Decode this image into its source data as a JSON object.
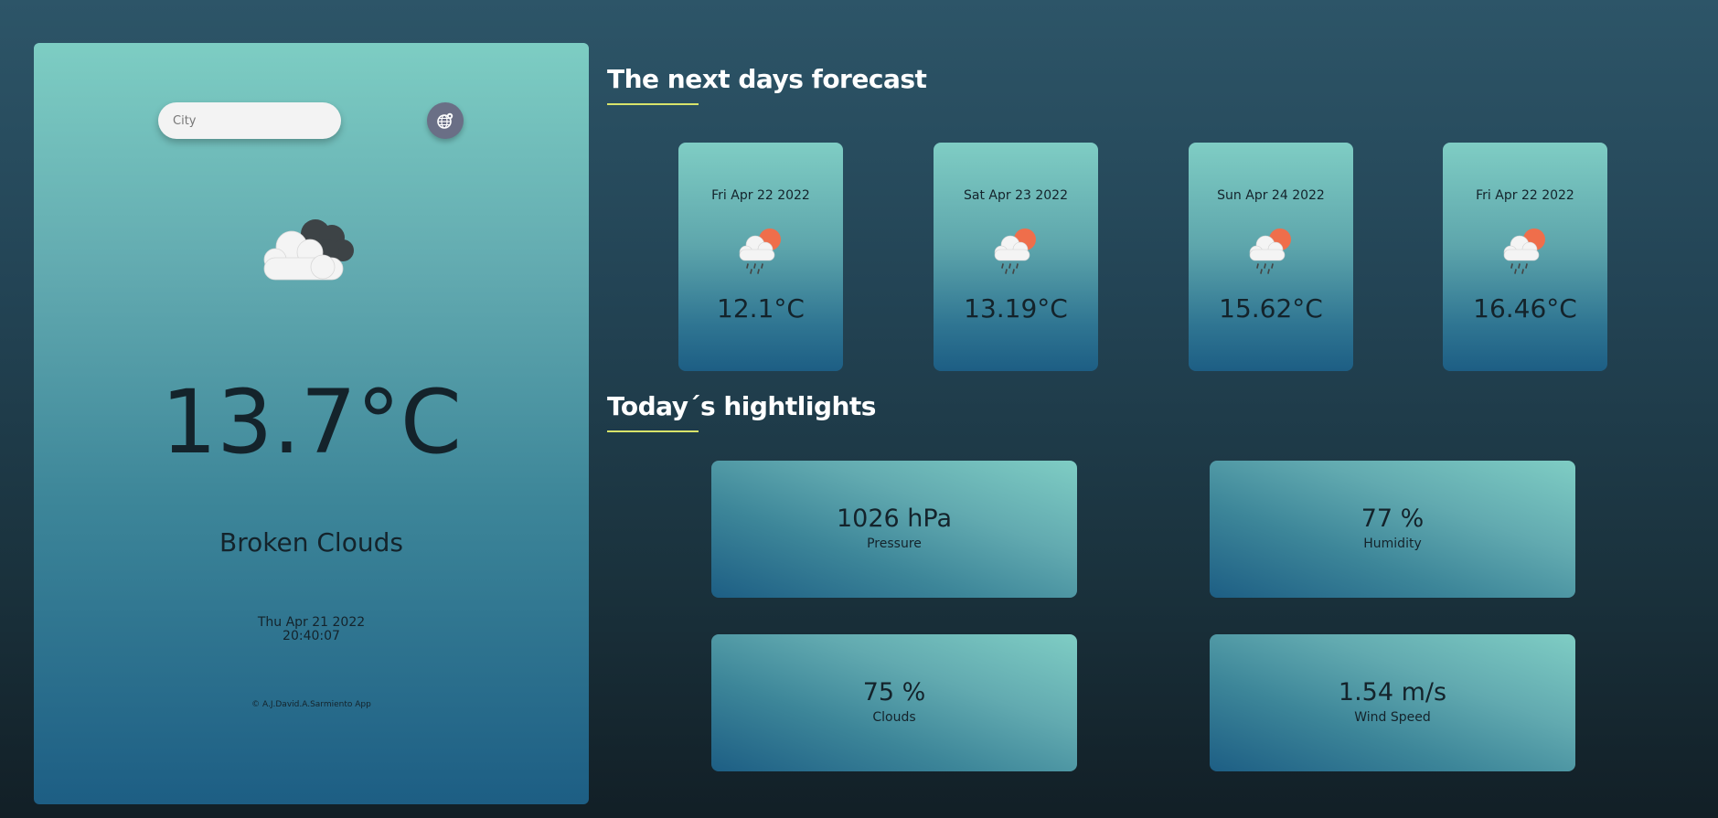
{
  "search": {
    "placeholder": "City"
  },
  "current": {
    "temperature": "13.7°C",
    "description": "Broken Clouds",
    "date": "Thu Apr 21 2022",
    "time": "20:40:07",
    "icon": "broken-clouds-icon"
  },
  "footer": "© A.J.David.A.Sarmiento App",
  "forecast_title": "The next days forecast",
  "highlights_title": "Today´s hightlights",
  "forecast": [
    {
      "date": "Fri Apr 22 2022",
      "temp": "12.1°C",
      "icon": "rain-sun-icon"
    },
    {
      "date": "Sat Apr 23 2022",
      "temp": "13.19°C",
      "icon": "rain-sun-icon"
    },
    {
      "date": "Sun Apr 24 2022",
      "temp": "15.62°C",
      "icon": "rain-sun-icon"
    },
    {
      "date": "Fri Apr 22 2022",
      "temp": "16.46°C",
      "icon": "rain-sun-icon"
    }
  ],
  "highlights": [
    {
      "value": "1026 hPa",
      "label": "Pressure"
    },
    {
      "value": "77 %",
      "label": "Humidity"
    },
    {
      "value": "75 %",
      "label": "Clouds"
    },
    {
      "value": "1.54 m/s",
      "label": "Wind Speed"
    }
  ],
  "colors": {
    "accent_underline": "#d8e36a",
    "sun": "#ef6e4b",
    "globe_button": "#6a6f86"
  }
}
